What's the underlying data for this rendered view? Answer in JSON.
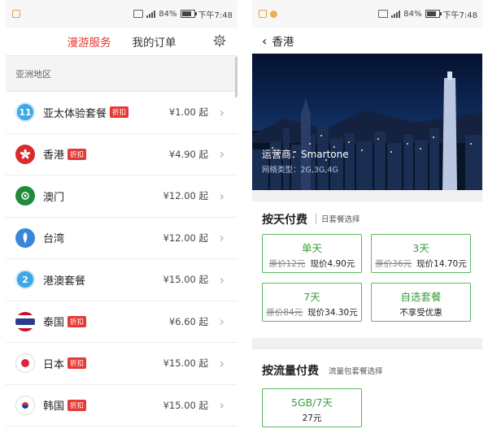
{
  "status_bar": {
    "battery": "84%",
    "time": "下午7:48"
  },
  "left": {
    "tabs": [
      "漫游服务",
      "我的订单"
    ],
    "section": "亚洲地区",
    "items": [
      {
        "name": "亚太体验套餐",
        "badge": "折扣",
        "price": "¥1.00 起",
        "flag_text": "11",
        "flag_color": "#3fa7e8"
      },
      {
        "name": "香港",
        "badge": "折扣",
        "price": "¥4.90 起",
        "flag_text": "",
        "flag_color": "#d92b2b"
      },
      {
        "name": "澳门",
        "badge": "",
        "price": "¥12.00 起",
        "flag_text": "",
        "flag_color": "#1e8a3a"
      },
      {
        "name": "台湾",
        "badge": "",
        "price": "¥12.00 起",
        "flag_text": "",
        "flag_color": "#3a86d8"
      },
      {
        "name": "港澳套餐",
        "badge": "",
        "price": "¥15.00 起",
        "flag_text": "2",
        "flag_color": "#3fa7e8"
      },
      {
        "name": "泰国",
        "badge": "折扣",
        "price": "¥6.60 起",
        "flag_text": "",
        "flag_color": "#2a3b8f"
      },
      {
        "name": "日本",
        "badge": "折扣",
        "price": "¥15.00 起",
        "flag_text": "",
        "flag_color": "#ffffff"
      },
      {
        "name": "韩国",
        "badge": "折扣",
        "price": "¥15.00 起",
        "flag_text": "",
        "flag_color": "#ffffff"
      }
    ]
  },
  "right": {
    "back_title": "香港",
    "operator": "运营商：Smartone",
    "network": "网络类型：2G,3G,4G",
    "day_section": {
      "title": "按天付费",
      "subtitle": "日套餐选择"
    },
    "day_plans": [
      {
        "name": "单天",
        "orig": "原价12元",
        "now": "现价4.90元"
      },
      {
        "name": "3天",
        "orig": "原价36元",
        "now": "现价14.70元"
      },
      {
        "name": "7天",
        "orig": "原价84元",
        "now": "现价34.30元"
      },
      {
        "name": "自选套餐",
        "orig": "",
        "now": "不享受优惠"
      }
    ],
    "data_section": {
      "title": "按流量付费",
      "subtitle": "流量包套餐选择"
    },
    "data_plans": [
      {
        "name": "5GB/7天",
        "now": "27元"
      }
    ]
  },
  "colors": {
    "accent_red": "#e53935",
    "plan_green": "#3a9d3a"
  }
}
